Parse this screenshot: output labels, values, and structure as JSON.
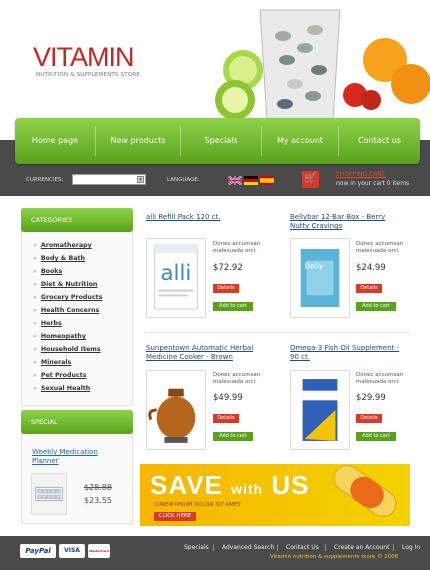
{
  "header": {
    "logo_title": "VITAMIN",
    "logo_sub": "NUTRITION & SUPPLEMENTS STORE"
  },
  "nav": [
    "Home page",
    "New products",
    "Specials",
    "My account",
    "Contact us"
  ],
  "tools": {
    "currencies_label": "CURRENCIES:",
    "language_label": "LANGUAGE:",
    "cart_title": "SHOPPING CART:",
    "cart_info": "now in your cart 0 items"
  },
  "sidebar": {
    "categories_title": "CATEGORIES",
    "categories": [
      "Aromatherapy",
      "Body & Bath",
      "Books",
      "Diet & Nutrition",
      "Grocery Products",
      "Health Concerns",
      "Herbs",
      "Homeopathy",
      "Household Items",
      "Minerals",
      "Pet Products",
      "Sexual Health"
    ],
    "special_title": "SPECIAL",
    "special_name": "Weekly Medication Planner",
    "special_old": "$28.88",
    "special_new": "$23.55"
  },
  "products": [
    {
      "title": "alli Refill Pack 120 ct.",
      "desc": "Donec accumsan malesuada orci.",
      "price": "$72.92",
      "details": "Details",
      "add": "Add to cart"
    },
    {
      "title": "Bellybar 12-Bar Box - Berry Nutty Cravings",
      "desc": "Donec accumsan malesuada orci.",
      "price": "$24.99",
      "details": "Details",
      "add": "Add to cart"
    },
    {
      "title": "Sunpentown Automatic Herbal Medicine Cooker - Brown",
      "desc": "Donec accumsan malesuada orci.",
      "price": "$49.99",
      "details": "Details",
      "add": "Add to cart"
    },
    {
      "title": "Omega-3 Fish Oil Supplement - 90 ct.",
      "desc": "Donec accumsan malesuada orci.",
      "price": "$29.99",
      "details": "Details",
      "add": "Add to cart"
    }
  ],
  "banner": {
    "title_big": "SAVE",
    "title_small": "with",
    "title_end": "US",
    "sub": "LOREM IPSUM DOLOR SIT AMET",
    "button": "CLICK HERE"
  },
  "footer": {
    "links": [
      "Specials",
      "Advanced Search",
      "Contact Us",
      "Create an Account",
      "Log In"
    ],
    "copyright": "Vitamin nutrition & supplements store © 2008",
    "payment": [
      "PayPal",
      "VISA",
      "MasterCard"
    ]
  },
  "colors": {
    "accent_green": "#5aa21c",
    "accent_red": "#d83a2a",
    "logo_red": "#c2281e",
    "dark_bar": "#4a4a4a"
  }
}
